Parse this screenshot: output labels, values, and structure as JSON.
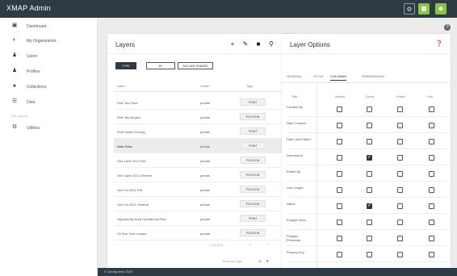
{
  "app": {
    "title": "XMAP Admin"
  },
  "topbar": {
    "icons": [
      "gear-icon",
      "grid-icon",
      "user-icon"
    ]
  },
  "sidebar": {
    "items": [
      {
        "label": "Dashboard",
        "icon": "dashboard-icon"
      },
      {
        "label": "My Organisation",
        "icon": "globe-icon"
      },
      {
        "label": "Users",
        "icon": "user-icon"
      },
      {
        "label": "Profiles",
        "icon": "group-icon"
      },
      {
        "label": "Collections",
        "icon": "collection-icon"
      },
      {
        "label": "Data",
        "icon": "table-icon"
      }
    ],
    "section_label": "File Upload",
    "extra_item": {
      "label": "Utilities",
      "icon": "gear-icon"
    }
  },
  "layers": {
    "title": "Layers",
    "tools": [
      "plus-icon",
      "pencil-icon",
      "trash-icon",
      "search-icon"
    ],
    "filters": [
      "TYPE",
      "BY",
      "INCLUDE SHARED"
    ],
    "columns": {
      "name": "Layer ↑",
      "owner": "Owner",
      "type": "Type"
    },
    "rows": [
      {
        "name": "Peel Tax Point",
        "owner": "private",
        "type": "POINT"
      },
      {
        "name": "Peel Tax Region",
        "owner": "private",
        "type": "POLYGON"
      },
      {
        "name": "Peel Under Occupy",
        "owner": "private",
        "type": "POINT"
      },
      {
        "name": "Nine Pubs",
        "owner": "private",
        "type": "POINT"
      },
      {
        "name": "One Lane 2011 Poll",
        "owner": "private",
        "type": "POLYGON"
      },
      {
        "name": "One Lane 2011 General",
        "owner": "private",
        "type": "POLYGON"
      },
      {
        "name": "One Ox 2011 Poll",
        "owner": "private",
        "type": "POLYGON"
      },
      {
        "name": "One Ox 2011 General",
        "owner": "private",
        "type": "POLYGON"
      },
      {
        "name": "Opportunity Area Operational Pilot",
        "owner": "private",
        "type": "POINT"
      },
      {
        "name": "Ox Bob One London",
        "owner": "private",
        "type": "POLYGON"
      }
    ],
    "pagination": {
      "range": "1–10 of 15",
      "prev": "‹",
      "next": "›",
      "per_page_label": "Rows per page:",
      "per_page": "10"
    }
  },
  "options": {
    "title": "Layer Options",
    "tabs": [
      "GENERAL",
      "STYLE",
      "COLUMNS",
      "PERMISSIONS"
    ],
    "active_tab": "COLUMNS",
    "columns": [
      "Title ↑",
      "Search",
      "Query",
      "Public",
      "Link"
    ],
    "rows": [
      {
        "field": "Created By",
        "checks": [
          false,
          false,
          false,
          false
        ]
      },
      {
        "field": "Date Created",
        "checks": [
          false,
          false,
          false,
          false
        ]
      },
      {
        "field": "Date Last Edited",
        "checks": [
          false,
          false,
          false,
          false
        ]
      },
      {
        "field": "Description",
        "checks": [
          false,
          true,
          false,
          false
        ]
      },
      {
        "field": "Edited By",
        "checks": [
          false,
          false,
          false,
          false
        ]
      },
      {
        "field": "Link Length",
        "checks": [
          false,
          false,
          false,
          false
        ]
      },
      {
        "field": "Name",
        "checks": [
          false,
          true,
          false,
          false
        ]
      },
      {
        "field": "Polygon Area",
        "checks": [
          false,
          false,
          false,
          false
        ]
      },
      {
        "field": "Polygon Perimeter",
        "checks": [
          false,
          false,
          false,
          false
        ]
      },
      {
        "field": "Primary Key",
        "checks": [
          false,
          false,
          false,
          false
        ]
      }
    ]
  },
  "footer": {
    "text": "© GeoSpheric 2019"
  },
  "colors": {
    "header": "#2e3a44",
    "accent": "#8bc34a",
    "checked": "#2e3a44"
  }
}
